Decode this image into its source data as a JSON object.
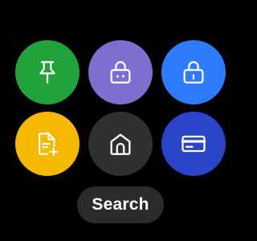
{
  "tiles": [
    {
      "id": "pin",
      "icon": "pin-icon",
      "color": "#21a23a"
    },
    {
      "id": "lock-purple",
      "icon": "lock-icon",
      "color": "#7c6fd0"
    },
    {
      "id": "lock-blue",
      "icon": "lock-icon",
      "color": "#2f7bff"
    },
    {
      "id": "new-document",
      "icon": "file-add-icon",
      "color": "#f7b800"
    },
    {
      "id": "home",
      "icon": "home-icon",
      "color": "#303030"
    },
    {
      "id": "payment-card",
      "icon": "credit-card-icon",
      "color": "#2a45c8"
    }
  ],
  "search": {
    "label": "Search",
    "color": "#2b2b2b"
  }
}
